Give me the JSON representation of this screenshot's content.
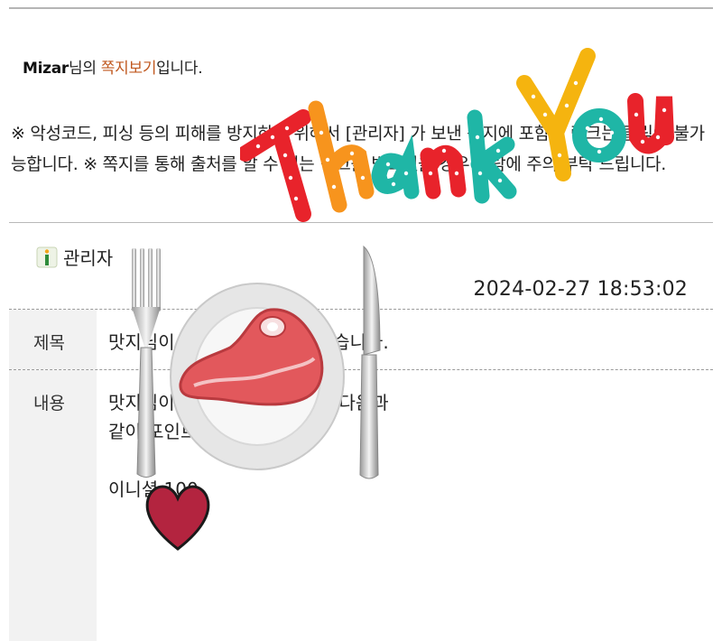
{
  "header": {
    "username": "Mizar",
    "suffix_1": "님의 ",
    "link": "쪽지보기",
    "suffix_2": "입니다."
  },
  "notice": "※ 악성코드, 피싱 등의 피해를 방지하기 위해서 [관리자] 가 보낸 쪽지에 포함된 링크는 클릭이 불가능합니다. ※ 쪽지를 통해 출처를 알 수 없는 링크를 받으셨을 경우 열람에 주의 부탁 드립니다.",
  "message": {
    "sender": "관리자",
    "date": "2024-02-27 18:53:02",
    "subject_label": "제목",
    "subject": "맛지님이 아이템(를) 사용하였습니다.",
    "content_label": "내용",
    "content_lines": [
      "맛지님이 아이템(를) 사용하여 다음과",
      "같이 포인트를 받았습니다.",
      "",
      "이니셜 100"
    ]
  },
  "stickers": {
    "thank_you_text": "Thank You",
    "colors": {
      "red": "#e8232b",
      "teal": "#1fb6a6",
      "yellow": "#f5b40f",
      "orange": "#f7941d",
      "heart": "#b3243f"
    }
  },
  "icons": {
    "sender_icon": "admin-badge-icon"
  }
}
